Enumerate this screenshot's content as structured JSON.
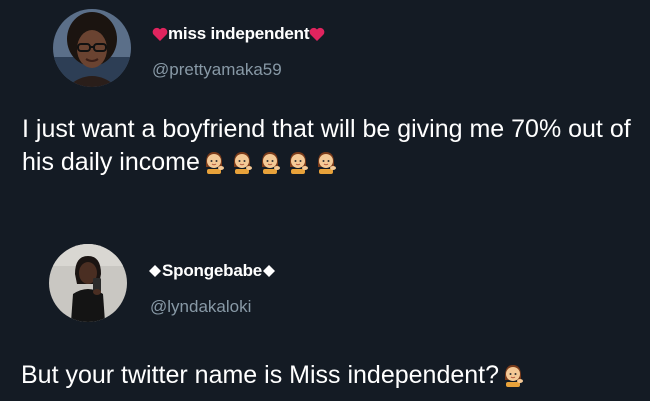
{
  "tweets": [
    {
      "display_name": "miss independent",
      "handle": "@prettyamaka59",
      "text": "I just want a boyfriend that will be giving me 70% out of his daily income",
      "name_decoration": "heart",
      "emoji_icon": "woman-tipping-hand-emoji",
      "emoji_count": 5
    },
    {
      "display_name": "Spongebabe",
      "handle": "@lyndakaloki",
      "text": "But your twitter name is Miss independent?",
      "name_decoration": "diamond",
      "emoji_icon": "woman-tipping-hand-emoji",
      "emoji_count": 1
    }
  ],
  "colors": {
    "background": "#141b24",
    "text": "#ffffff",
    "handle": "#8899a6",
    "heart": "#e0245e"
  }
}
